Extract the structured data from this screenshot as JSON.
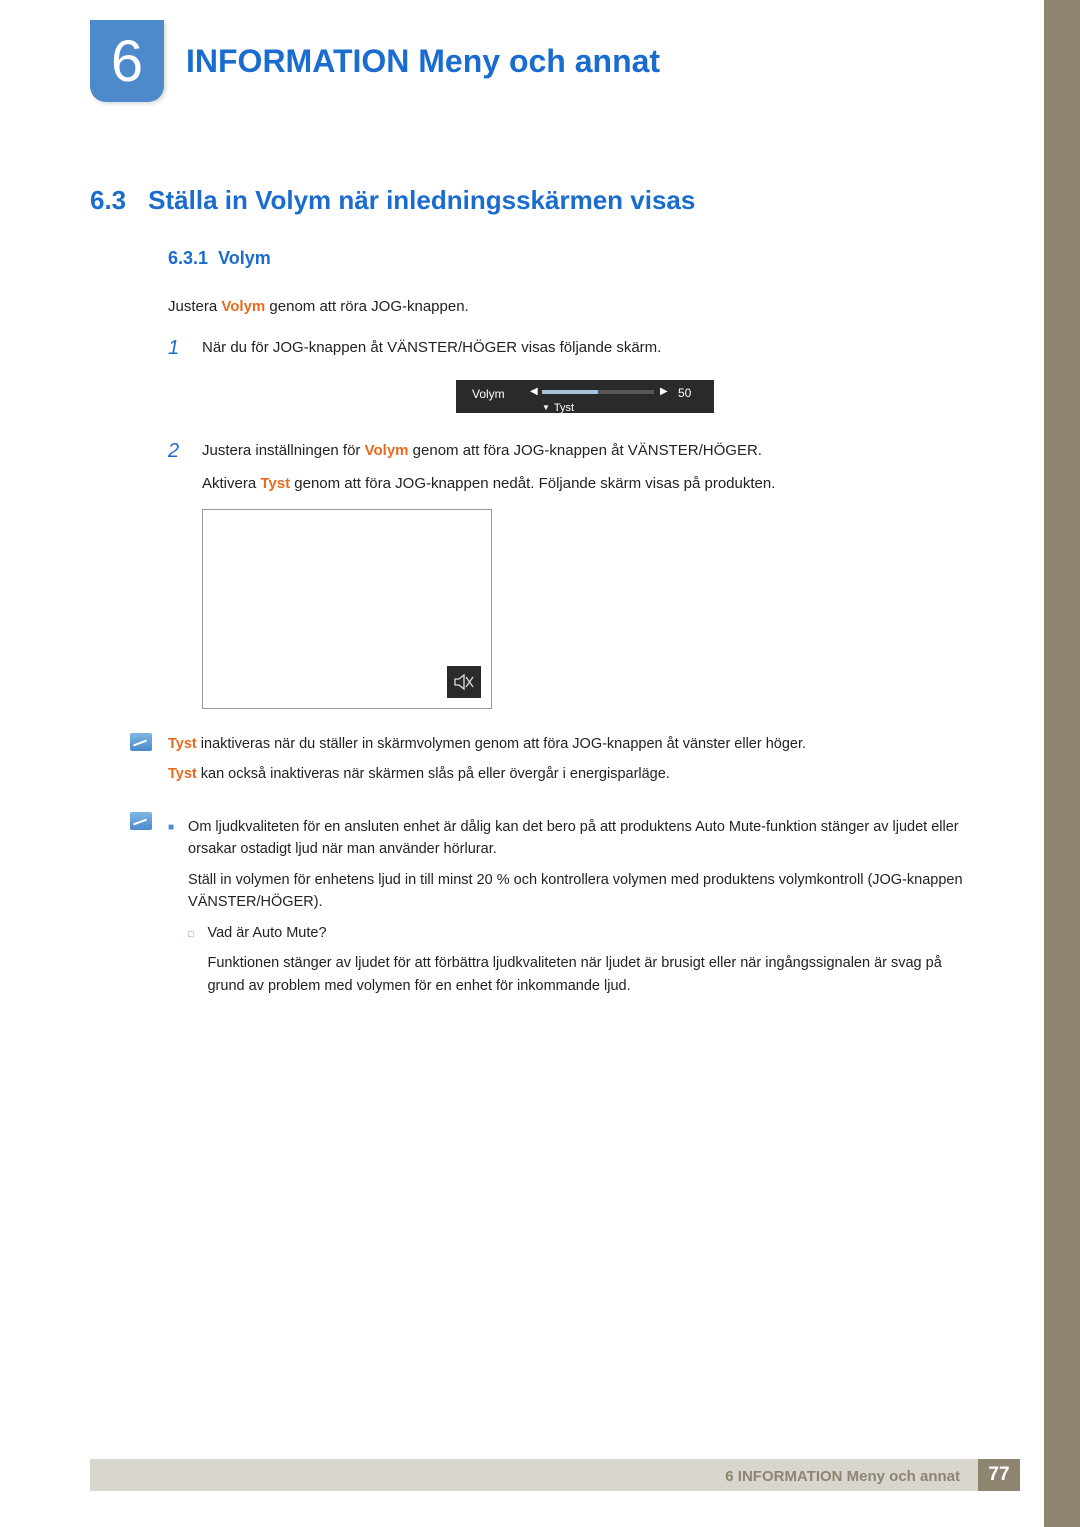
{
  "chapter": {
    "number": "6",
    "title": "INFORMATION Meny och annat"
  },
  "section": {
    "number": "6.3",
    "title": "Ställa in Volym när inledningsskärmen visas"
  },
  "subsection": {
    "number": "6.3.1",
    "title": "Volym"
  },
  "intro": {
    "pre": "Justera ",
    "hl": "Volym",
    "post": " genom att röra JOG-knappen."
  },
  "steps": {
    "one": {
      "num": "1",
      "text": "När du för JOG-knappen åt VÄNSTER/HÖGER visas följande skärm."
    },
    "two": {
      "num": "2",
      "line1": {
        "pre": "Justera inställningen för ",
        "hl": "Volym",
        "post": " genom att föra JOG-knappen åt VÄNSTER/HÖGER."
      },
      "line2": {
        "pre": "Aktivera ",
        "hl": "Tyst",
        "post": " genom att föra JOG-knappen nedåt. Följande skärm visas på produkten."
      }
    }
  },
  "volume_osd": {
    "label": "Volym",
    "value": "50",
    "tyst": "Tyst"
  },
  "note1": {
    "line1": {
      "hl": "Tyst",
      "post": " inaktiveras när du ställer in skärmvolymen genom att föra JOG-knappen åt vänster eller höger."
    },
    "line2": {
      "hl": "Tyst",
      "post": " kan också inaktiveras när skärmen slås på eller övergår i energisparläge."
    }
  },
  "note2": {
    "b1": "Om ljudkvaliteten för en ansluten enhet är dålig kan det bero på att produktens Auto Mute-funktion stänger av ljudet eller orsakar ostadigt ljud när man använder hörlurar.",
    "b1b": "Ställ in volymen för enhetens ljud in till minst 20 % och kontrollera volymen med produktens volymkontroll (JOG-knappen VÄNSTER/HÖGER).",
    "sub_q": "Vad är Auto Mute?",
    "sub_a": "Funktionen stänger av ljudet för att förbättra ljudkvaliteten när ljudet är brusigt eller när ingångssignalen är svag på grund av problem med volymen för en enhet för inkommande ljud."
  },
  "footer": {
    "label": "6 INFORMATION Meny och annat",
    "page": "77"
  }
}
